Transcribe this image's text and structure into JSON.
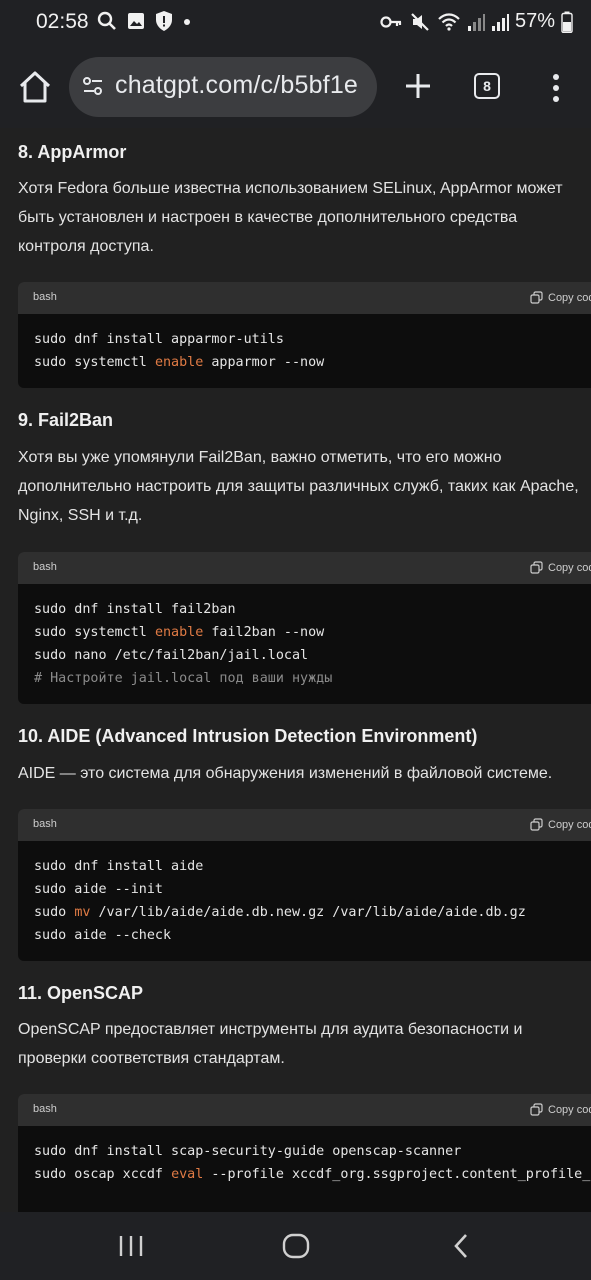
{
  "status": {
    "time": "02:58",
    "battery": "57%"
  },
  "browser": {
    "url": "chatgpt.com/c/b5bf1e",
    "tab_count": "8"
  },
  "sections": [
    {
      "heading": "8. AppArmor",
      "paragraph": [
        "Хотя Fedora больше известна использованием SELinux, AppArmor может",
        "быть установлен и настроен в качестве дополнительного средства",
        "контроля доступа."
      ],
      "code": {
        "lang": "bash",
        "copy": "Copy code",
        "lines": [
          [
            {
              "t": "sudo dnf install apparmor-utils"
            }
          ],
          [
            {
              "t": "sudo systemctl "
            },
            {
              "t": "enable",
              "c": "kw"
            },
            {
              "t": " apparmor --now"
            }
          ]
        ]
      }
    },
    {
      "heading": "9. Fail2Ban",
      "paragraph": [
        "Хотя вы уже упомянули Fail2Ban, важно отметить, что его можно",
        "дополнительно настроить для защиты различных служб, таких как Apache,",
        "Nginx, SSH и т.д."
      ],
      "code": {
        "lang": "bash",
        "copy": "Copy code",
        "lines": [
          [
            {
              "t": "sudo dnf install fail2ban"
            }
          ],
          [
            {
              "t": "sudo systemctl "
            },
            {
              "t": "enable",
              "c": "kw"
            },
            {
              "t": " fail2ban --now"
            }
          ],
          [
            {
              "t": "sudo nano /etc/fail2ban/jail.local"
            }
          ],
          [
            {
              "t": "# Настройте jail.local под ваши нужды",
              "c": "cm"
            }
          ]
        ]
      }
    },
    {
      "heading": "10. AIDE (Advanced Intrusion Detection Environment)",
      "paragraph": [
        "AIDE — это система для обнаружения изменений в файловой системе."
      ],
      "code": {
        "lang": "bash",
        "copy": "Copy code",
        "lines": [
          [
            {
              "t": "sudo dnf install aide"
            }
          ],
          [
            {
              "t": "sudo aide --init"
            }
          ],
          [
            {
              "t": "sudo "
            },
            {
              "t": "mv",
              "c": "kw"
            },
            {
              "t": " /var/lib/aide/aide.db.new.gz /var/lib/aide/aide.db.gz"
            }
          ],
          [
            {
              "t": "sudo aide --check"
            }
          ]
        ]
      }
    },
    {
      "heading": "11. OpenSCAP",
      "paragraph": [
        "OpenSCAP предоставляет инструменты для аудита безопасности и",
        "проверки соответствия стандартам."
      ],
      "code": {
        "lang": "bash",
        "copy": "Copy code",
        "lines": [
          [
            {
              "t": "sudo dnf install scap-security-guide openscap-scanner"
            }
          ],
          [
            {
              "t": "sudo oscap xccdf "
            },
            {
              "t": "eval",
              "c": "kw"
            },
            {
              "t": " --profile xccdf_org.ssgproject.content_profile_stig"
            }
          ]
        ]
      }
    }
  ],
  "colors": {
    "background": "#212121",
    "code_background": "#0d0d0d",
    "code_header": "#2f2f2f",
    "keyword": "#e07b45",
    "comment": "#8b8b8b"
  }
}
